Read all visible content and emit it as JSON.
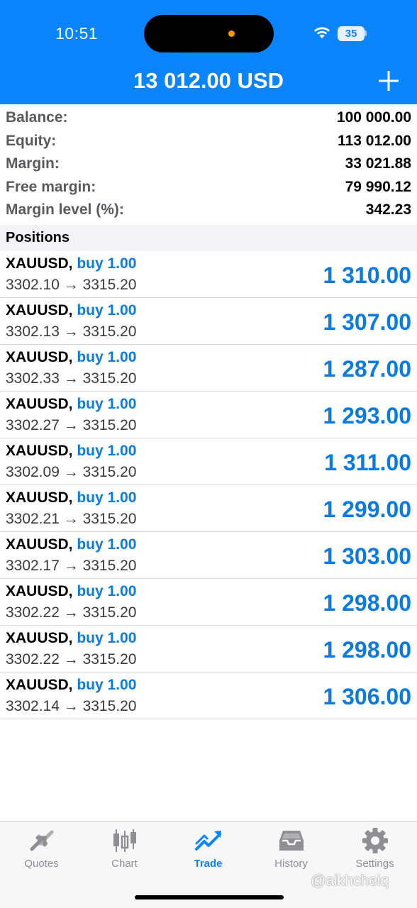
{
  "status_bar": {
    "time": "10:51",
    "battery": "35"
  },
  "header": {
    "title": "13 012.00 USD"
  },
  "summary": [
    {
      "label": "Balance:",
      "value": "100 000.00"
    },
    {
      "label": "Equity:",
      "value": "113 012.00"
    },
    {
      "label": "Margin:",
      "value": "33 021.88"
    },
    {
      "label": "Free margin:",
      "value": "79 990.12"
    },
    {
      "label": "Margin level (%):",
      "value": "342.23"
    }
  ],
  "positions_header": "Positions",
  "positions": [
    {
      "symbol": "XAUUSD,",
      "type": "buy 1.00",
      "prices": "3302.10 → 3315.20",
      "profit": "1 310.00"
    },
    {
      "symbol": "XAUUSD,",
      "type": "buy 1.00",
      "prices": "3302.13 → 3315.20",
      "profit": "1 307.00"
    },
    {
      "symbol": "XAUUSD,",
      "type": "buy 1.00",
      "prices": "3302.33 → 3315.20",
      "profit": "1 287.00"
    },
    {
      "symbol": "XAUUSD,",
      "type": "buy 1.00",
      "prices": "3302.27 → 3315.20",
      "profit": "1 293.00"
    },
    {
      "symbol": "XAUUSD,",
      "type": "buy 1.00",
      "prices": "3302.09 → 3315.20",
      "profit": "1 311.00"
    },
    {
      "symbol": "XAUUSD,",
      "type": "buy 1.00",
      "prices": "3302.21 → 3315.20",
      "profit": "1 299.00"
    },
    {
      "symbol": "XAUUSD,",
      "type": "buy 1.00",
      "prices": "3302.17 → 3315.20",
      "profit": "1 303.00"
    },
    {
      "symbol": "XAUUSD,",
      "type": "buy 1.00",
      "prices": "3302.22 → 3315.20",
      "profit": "1 298.00"
    },
    {
      "symbol": "XAUUSD,",
      "type": "buy 1.00",
      "prices": "3302.22 → 3315.20",
      "profit": "1 298.00"
    },
    {
      "symbol": "XAUUSD,",
      "type": "buy 1.00",
      "prices": "3302.14 → 3315.20",
      "profit": "1 306.00"
    }
  ],
  "tabs": [
    {
      "label": "Quotes",
      "icon": "quotes-icon"
    },
    {
      "label": "Chart",
      "icon": "chart-icon"
    },
    {
      "label": "Trade",
      "icon": "trade-icon",
      "active": true
    },
    {
      "label": "History",
      "icon": "history-icon"
    },
    {
      "label": "Settings",
      "icon": "settings-icon"
    }
  ],
  "watermark": "@aikhcheiq",
  "colors": {
    "accent": "#0a84ff",
    "profit": "#0a7be0",
    "header_bg": "#0a84ff"
  }
}
